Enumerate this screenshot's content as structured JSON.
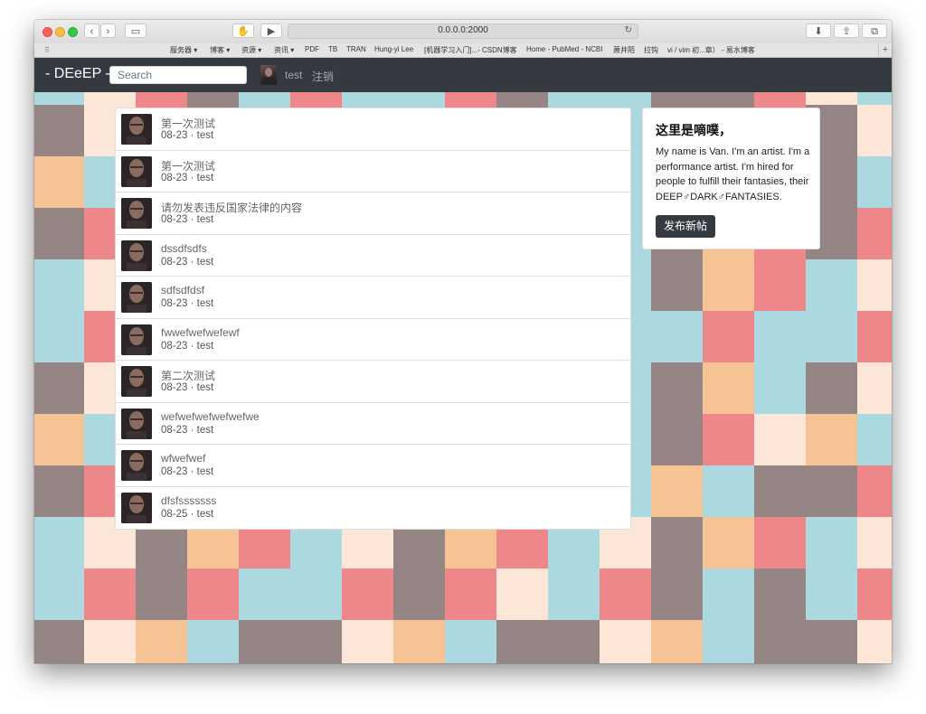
{
  "browser": {
    "url": "0.0.0.0:2000",
    "bookmarks": [
      "服务器 ▾",
      "博客 ▾",
      "资源 ▾",
      "资讯 ▾",
      "PDF",
      "TB",
      "TRAN",
      "Hung-yi Lee",
      "[机器学习入门]...- CSDN博客",
      "Home - PubMed - NCBI",
      "萧井陌",
      "拉钩",
      "vi / vim 初...章） - 易水博客"
    ]
  },
  "navbar": {
    "brand": "- DEeEP -",
    "search_placeholder": "Search",
    "username": "test",
    "logout": "注销"
  },
  "posts": [
    {
      "title": "第一次测试",
      "meta": "08-23 · test"
    },
    {
      "title": "第一次测试",
      "meta": "08-23 · test"
    },
    {
      "title": "请勿发表违反国家法律的内容",
      "meta": "08-23 · test"
    },
    {
      "title": "dssdfsdfs",
      "meta": "08-23 · test"
    },
    {
      "title": "sdfsdfdsf",
      "meta": "08-23 · test"
    },
    {
      "title": "fwwefwefwefewf",
      "meta": "08-23 · test"
    },
    {
      "title": "第二次测试",
      "meta": "08-23 · test"
    },
    {
      "title": "wefwefwefwefwefwe",
      "meta": "08-23 · test"
    },
    {
      "title": "wfwefwef",
      "meta": "08-23 · test"
    },
    {
      "title": "dfsfsssssss",
      "meta": "08-25 · test"
    }
  ],
  "sidebar": {
    "title": "这里是嘀噗，",
    "text": "My name is Van. I'm an artist. I'm a performance artist. I'm hired for people to fulfill their fantasies, their DEEP♂DARK♂FANTASIES.",
    "new_post": "发布新帖"
  },
  "colors": {
    "navbar": "#343a40",
    "tile_blue": "#acd8e0",
    "tile_pink": "#ed878a",
    "tile_taupe": "#958585",
    "tile_peach": "#f6c494",
    "tile_cream": "#fce6d8"
  }
}
